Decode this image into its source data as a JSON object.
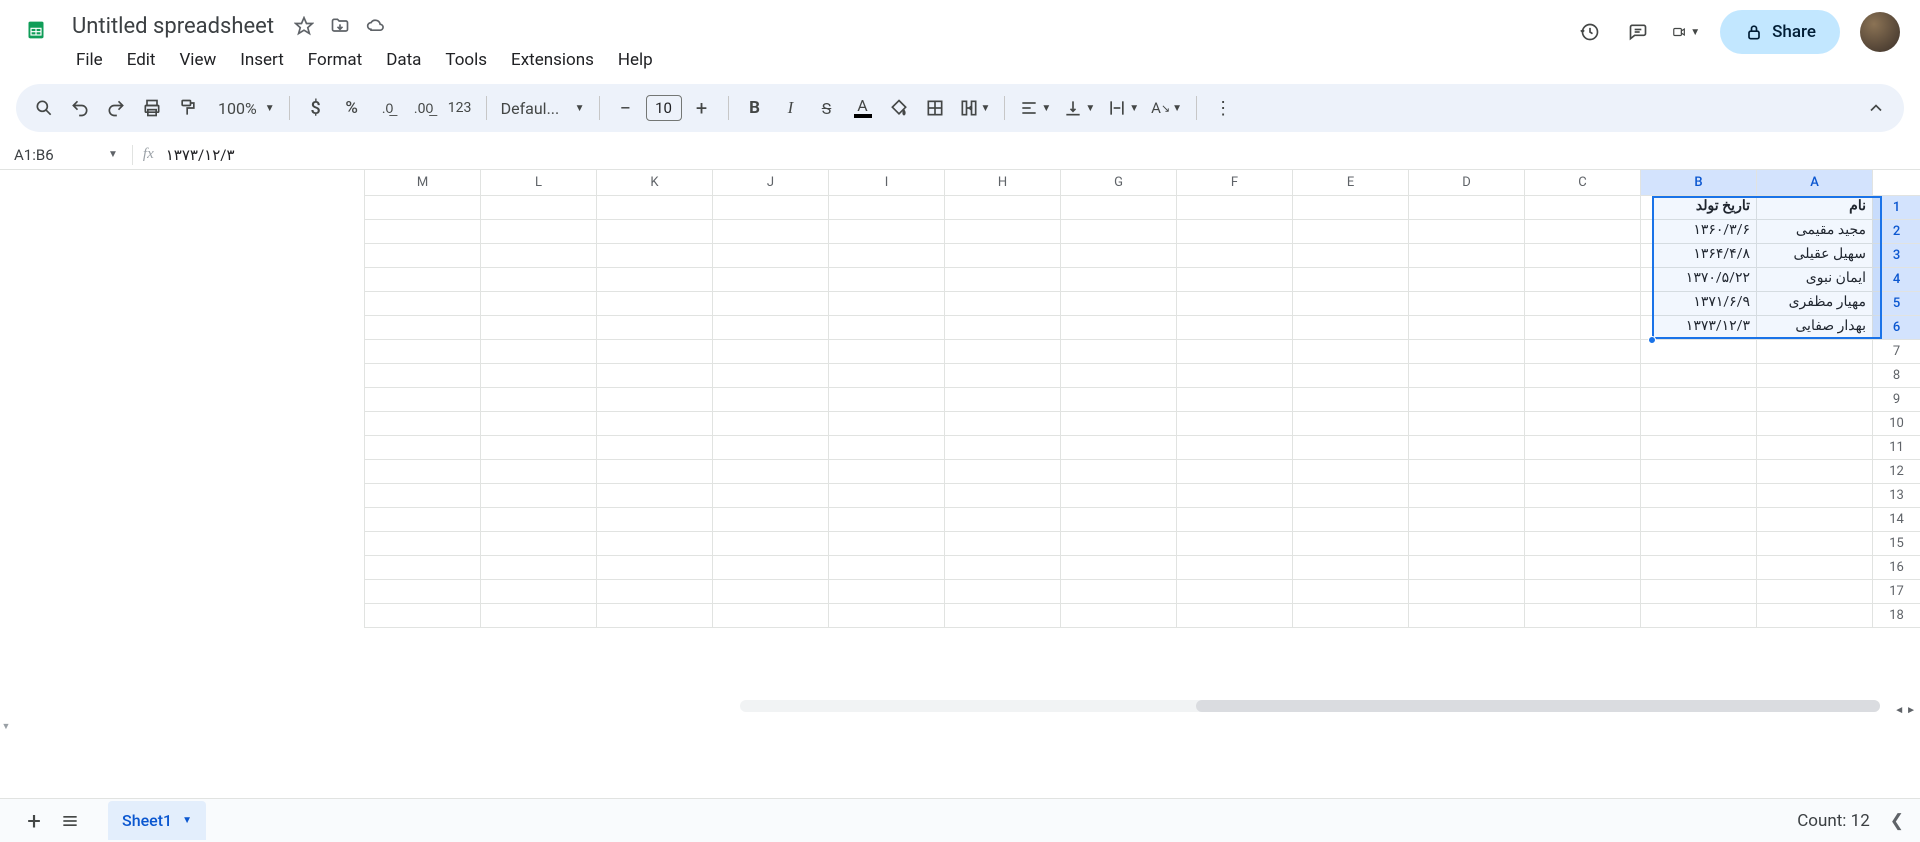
{
  "doc": {
    "title": "Untitled spreadsheet"
  },
  "menu": {
    "file": "File",
    "edit": "Edit",
    "view": "View",
    "insert": "Insert",
    "format": "Format",
    "data": "Data",
    "tools": "Tools",
    "extensions": "Extensions",
    "help": "Help"
  },
  "share": {
    "label": "Share"
  },
  "toolbar": {
    "zoom": "100%",
    "font": "Defaul...",
    "fontsize": "10",
    "fmt123": "123"
  },
  "namebox": {
    "value": "A1:B6"
  },
  "formula": {
    "value": "۱۳۷۳/۱۲/۳"
  },
  "columns": [
    "A",
    "B",
    "C",
    "D",
    "E",
    "F",
    "G",
    "H",
    "I",
    "J",
    "K",
    "L",
    "M"
  ],
  "selectedCols": [
    "A",
    "B"
  ],
  "rowCount": 18,
  "selectedRows": [
    1,
    2,
    3,
    4,
    5,
    6
  ],
  "cells": {
    "1": {
      "A": "نام",
      "B": "تاریخ تولد"
    },
    "2": {
      "A": "مجید مقیمی",
      "B": "۱۳۶۰/۳/۶"
    },
    "3": {
      "A": "سهیل عقیلی",
      "B": "۱۳۶۴/۴/۸"
    },
    "4": {
      "A": "ایمان نبوی",
      "B": "۱۳۷۰/۵/۲۲"
    },
    "5": {
      "A": "مهیار مظفری",
      "B": "۱۳۷۱/۶/۹"
    },
    "6": {
      "A": "بهدار صفایی",
      "B": "۱۳۷۳/۱۲/۳"
    }
  },
  "sheet": {
    "tab": "Sheet1"
  },
  "status": {
    "count_label": "Count: 12"
  }
}
